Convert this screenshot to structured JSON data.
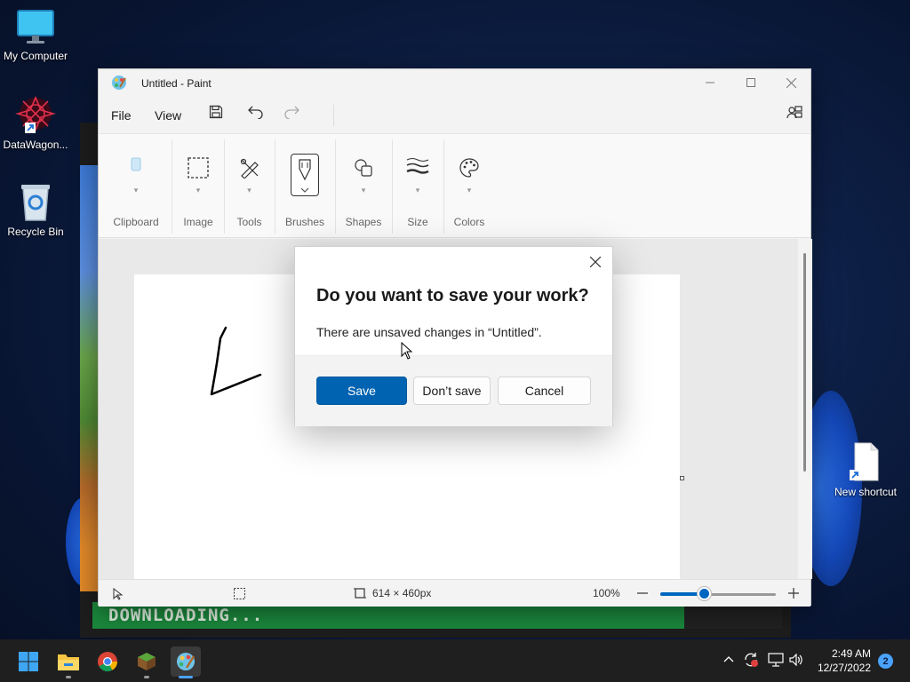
{
  "desktop": {
    "icons": [
      {
        "label": "My Computer"
      },
      {
        "label": "DataWagon..."
      },
      {
        "label": "Recycle Bin"
      },
      {
        "label": "New shortcut"
      }
    ]
  },
  "background_app": {
    "status_text": "DOWNLOADING..."
  },
  "paint": {
    "title": "Untitled - Paint",
    "menu": {
      "file": "File",
      "view": "View"
    },
    "ribbon": {
      "groups": [
        "Clipboard",
        "Image",
        "Tools",
        "Brushes",
        "Shapes",
        "Size",
        "Colors"
      ]
    },
    "status": {
      "dimensions": "614 × 460px",
      "zoom": "100%",
      "zoom_level": 0.38
    }
  },
  "dialog": {
    "title": "Do you want to save your work?",
    "message": "There are unsaved changes in “Untitled”.",
    "buttons": {
      "save": "Save",
      "dont_save": "Don’t save",
      "cancel": "Cancel"
    }
  },
  "taskbar": {
    "clock_time": "2:49 AM",
    "clock_date": "12/27/2022",
    "notification_count": "2"
  },
  "colors": {
    "accent": "#0063b1",
    "download_bar": "#1b8a3d",
    "taskbar": "#1f1f1f"
  }
}
